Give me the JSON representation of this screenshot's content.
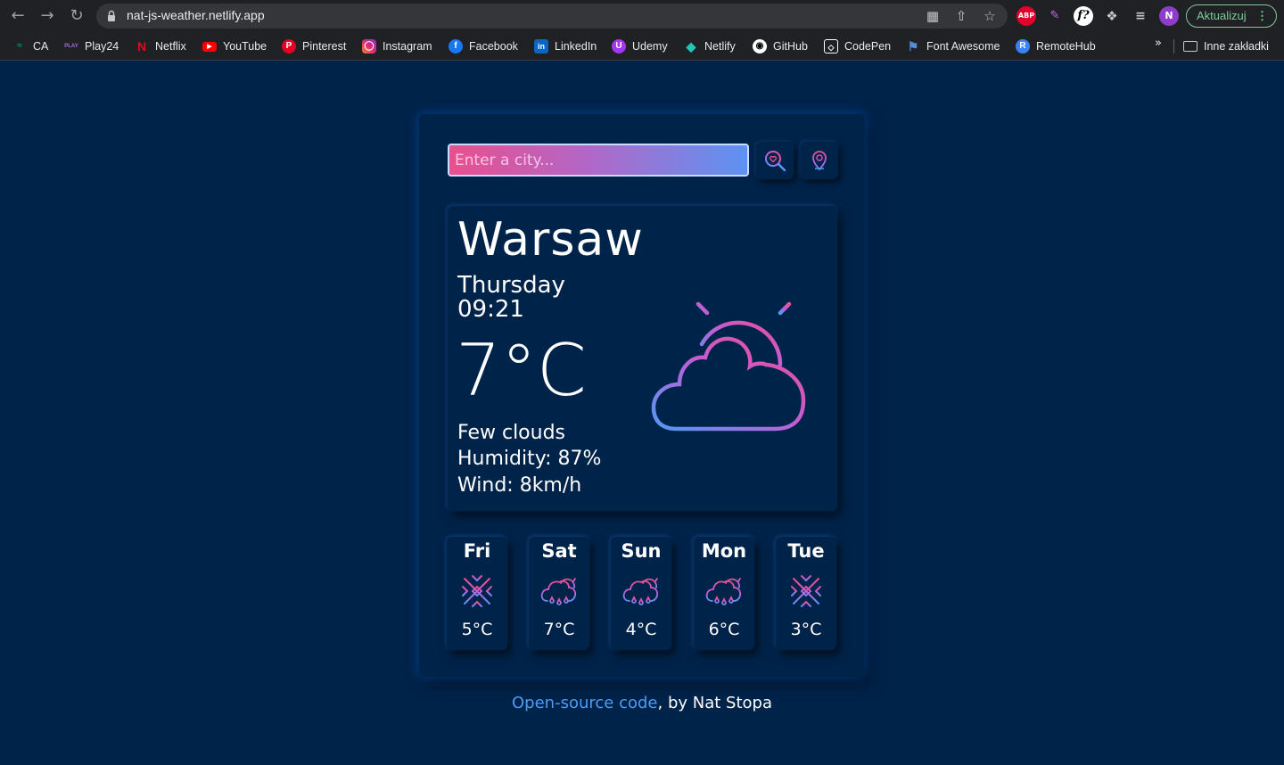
{
  "browser": {
    "url": "nat-js-weather.netlify.app",
    "update_label": "Aktualizuj",
    "bookmarks": [
      {
        "label": "CA",
        "color": "#0a8f6b"
      },
      {
        "label": "Play24",
        "color": "#7a2ac4"
      },
      {
        "label": "Netflix",
        "color": "#e50914"
      },
      {
        "label": "YouTube",
        "color": "#ff0000"
      },
      {
        "label": "Pinterest",
        "color": "#e60023"
      },
      {
        "label": "Instagram",
        "color": "#d6249f"
      },
      {
        "label": "Facebook",
        "color": "#1877f2"
      },
      {
        "label": "LinkedIn",
        "color": "#0a66c2"
      },
      {
        "label": "Udemy",
        "color": "#a435f0"
      },
      {
        "label": "Netlify",
        "color": "#20c6b7"
      },
      {
        "label": "GitHub",
        "color": "#ffffff"
      },
      {
        "label": "CodePen",
        "color": "#ffffff"
      },
      {
        "label": "Font Awesome",
        "color": "#538dd7"
      },
      {
        "label": "RemoteHub",
        "color": "#3b82f6"
      }
    ],
    "other_bookmarks": "Inne zakładki"
  },
  "search": {
    "placeholder": "Enter a city..."
  },
  "current": {
    "city": "Warsaw",
    "day": "Thursday",
    "time": "09:21",
    "temperature": "7°C",
    "description": "Few clouds",
    "humidity": "Humidity: 87%",
    "wind": "Wind: 8km/h",
    "icon": "partly-cloudy-icon"
  },
  "forecast": [
    {
      "day": "Fri",
      "temp": "5°C",
      "icon": "snowflake-icon"
    },
    {
      "day": "Sat",
      "temp": "7°C",
      "icon": "rain-cloud-icon"
    },
    {
      "day": "Sun",
      "temp": "4°C",
      "icon": "rain-cloud-icon"
    },
    {
      "day": "Mon",
      "temp": "6°C",
      "icon": "rain-cloud-icon"
    },
    {
      "day": "Tue",
      "temp": "3°C",
      "icon": "snowflake-icon"
    }
  ],
  "footer": {
    "link": "Open-source code",
    "rest": ", by Nat Stopa"
  },
  "colors": {
    "background": "#00234a",
    "gradient_pink": "#e8508e",
    "gradient_blue": "#5d93f3",
    "link": "#4b9cf5"
  }
}
